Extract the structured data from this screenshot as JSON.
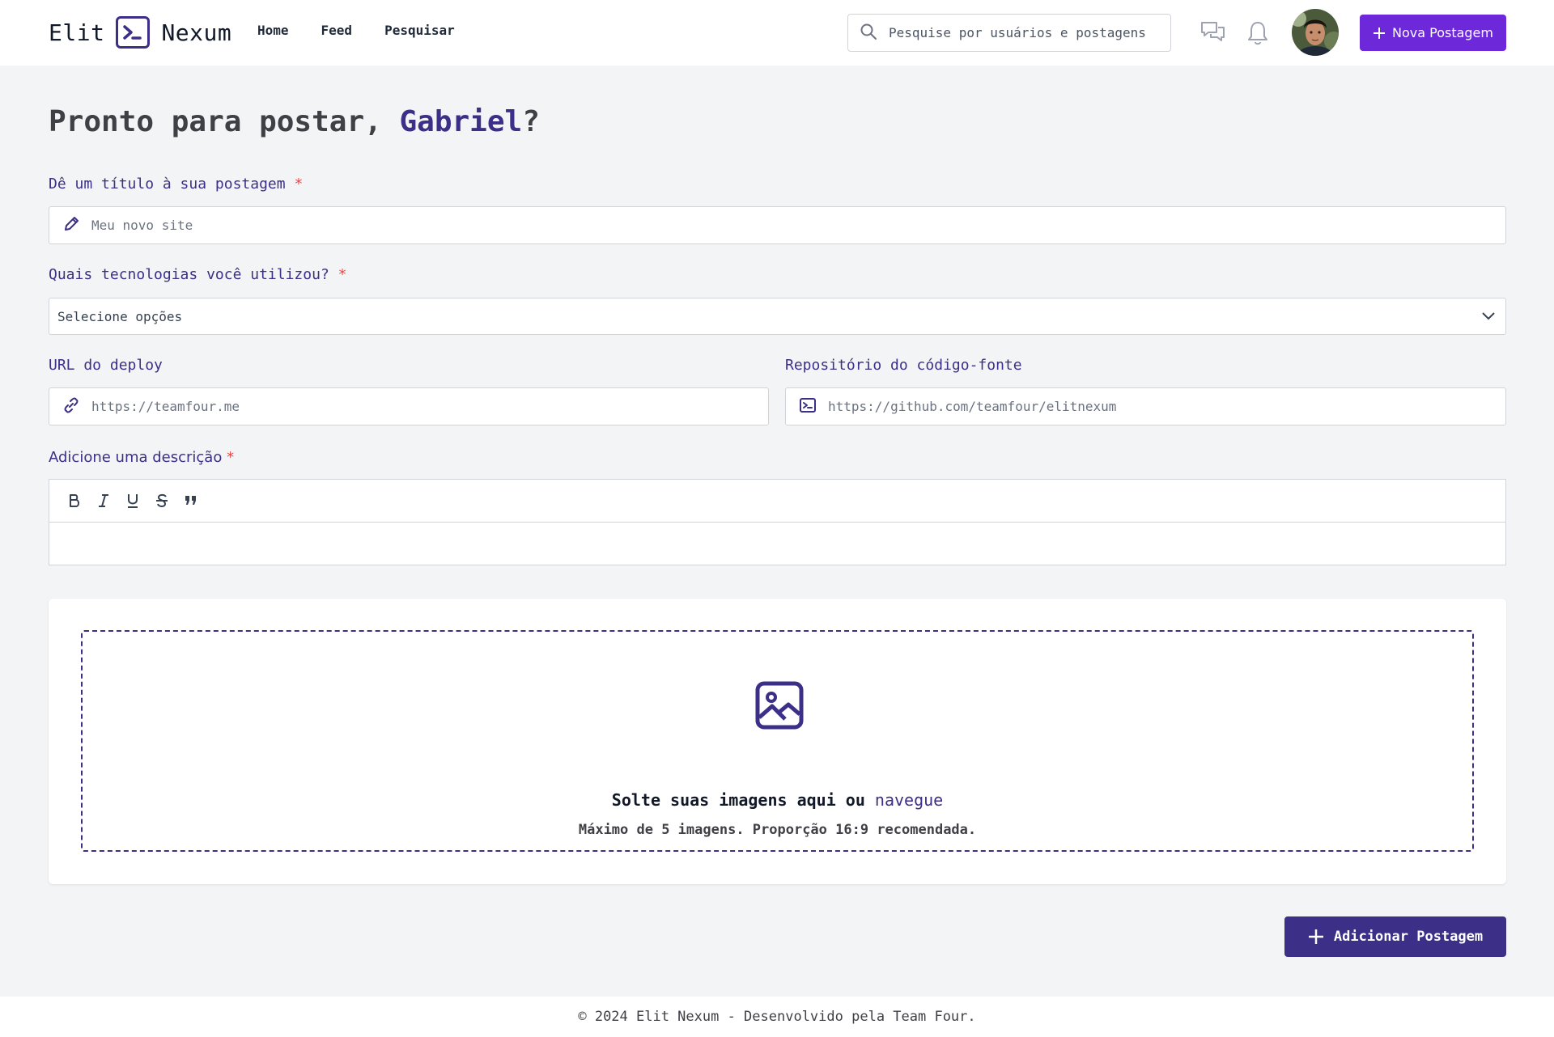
{
  "header": {
    "logo_left": "Elit",
    "logo_right": "Nexum",
    "nav": [
      "Home",
      "Feed",
      "Pesquisar"
    ],
    "search_placeholder": "Pesquise por usuários e postagens",
    "new_post_label": "Nova Postagem"
  },
  "page": {
    "title_prefix": "Pronto para postar, ",
    "title_name": "Gabriel",
    "title_suffix": "?"
  },
  "form": {
    "title_label": "Dê um título à sua postagem",
    "title_placeholder": "Meu novo site",
    "tech_label": "Quais tecnologias você utilizou?",
    "tech_placeholder": "Selecione opções",
    "deploy_label": "URL do deploy",
    "deploy_placeholder": "https://teamfour.me",
    "repo_label": "Repositório do código-fonte",
    "repo_placeholder": "https://github.com/teamfour/elitnexum",
    "desc_label": "Adicione uma descrição",
    "required_mark": "*"
  },
  "upload": {
    "main_text": "Solte suas imagens aqui ou ",
    "link_text": "navegue",
    "sub_text": "Máximo de 5 imagens. Proporção 16:9 recomendada."
  },
  "actions": {
    "add_post_label": "Adicionar Postagem"
  },
  "footer": {
    "text": "© 2024 Elit Nexum - Desenvolvido pela Team Four."
  },
  "colors": {
    "brand": "#3b2f87",
    "accent": "#6d28d9",
    "required": "#ef4444"
  }
}
